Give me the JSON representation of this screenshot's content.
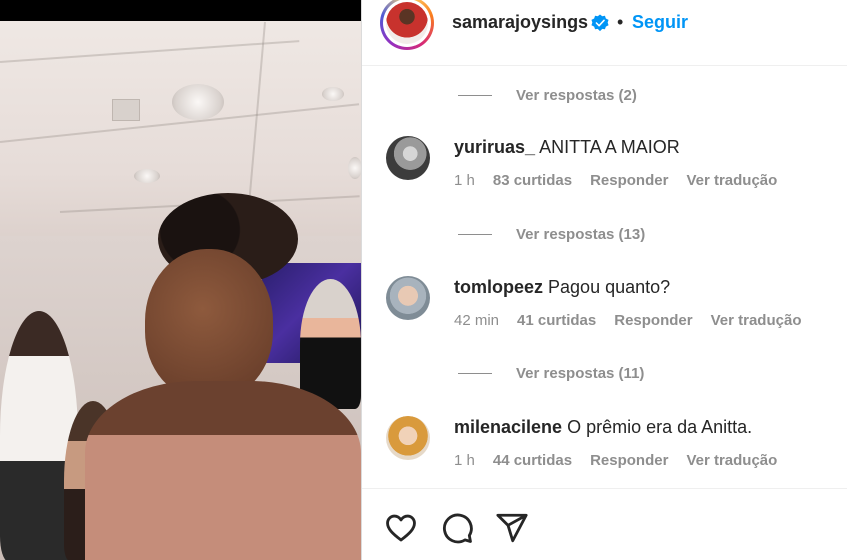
{
  "post": {
    "username": "samarajoysings",
    "separator": "•",
    "follow_label": "Seguir"
  },
  "replies": [
    {
      "label": "Ver respostas (2)"
    },
    {
      "label": "Ver respostas (13)"
    },
    {
      "label": "Ver respostas (11)"
    }
  ],
  "comments": [
    {
      "user": "yuriruas_",
      "text": "ANITTA A MAIOR",
      "time": "1 h",
      "likes": "83 curtidas",
      "reply": "Responder",
      "translate": "Ver tradução"
    },
    {
      "user": "tomlopeez",
      "text": "Pagou quanto?",
      "time": "42 min",
      "likes": "41 curtidas",
      "reply": "Responder",
      "translate": "Ver tradução"
    },
    {
      "user": "milenacilene",
      "text": "O prêmio era da Anitta.",
      "time": "1 h",
      "likes": "44 curtidas",
      "reply": "Responder",
      "translate": "Ver tradução"
    }
  ],
  "actions": {
    "like_icon": "heart-icon",
    "comment_icon": "comment-icon",
    "share_icon": "share-icon"
  },
  "colors": {
    "accent": "#0095f6",
    "verified": "#0095f6",
    "muted": "#8e8e8e",
    "text": "#262626"
  }
}
